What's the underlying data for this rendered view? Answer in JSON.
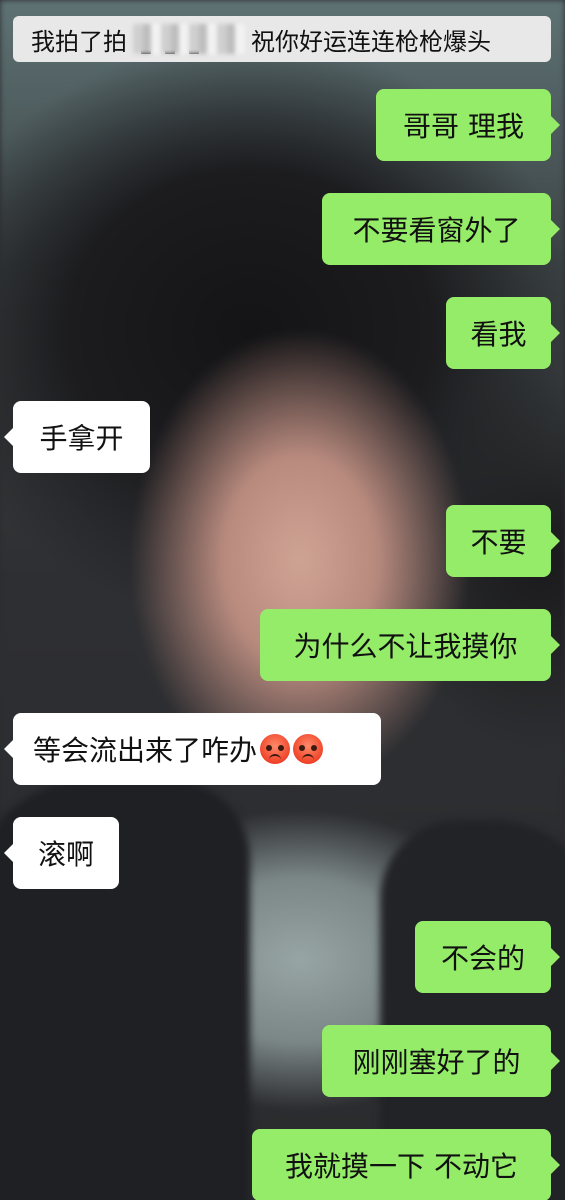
{
  "top_banner": {
    "text_before": "我拍了拍",
    "text_after": "祝你好运连连枪枪爆头"
  },
  "messages": [
    {
      "from": "me",
      "text": "哥哥 理我"
    },
    {
      "from": "me",
      "text": "不要看窗外了"
    },
    {
      "from": "me",
      "text": "看我"
    },
    {
      "from": "them",
      "text": "手拿开"
    },
    {
      "from": "me",
      "text": "不要"
    },
    {
      "from": "me",
      "text": "为什么不让我摸你"
    },
    {
      "from": "them",
      "text": "等会流出来了咋办",
      "emoji": [
        "angry-face-icon",
        "angry-face-icon"
      ]
    },
    {
      "from": "them",
      "text": "滚啊"
    },
    {
      "from": "me",
      "text": "不会的"
    },
    {
      "from": "me",
      "text": "刚刚塞好了的"
    },
    {
      "from": "me",
      "text": "我就摸一下 不动它"
    }
  ],
  "colors": {
    "my_bubble": "#95ec69",
    "their_bubble": "#ffffff",
    "banner": "#e8e8e8"
  }
}
